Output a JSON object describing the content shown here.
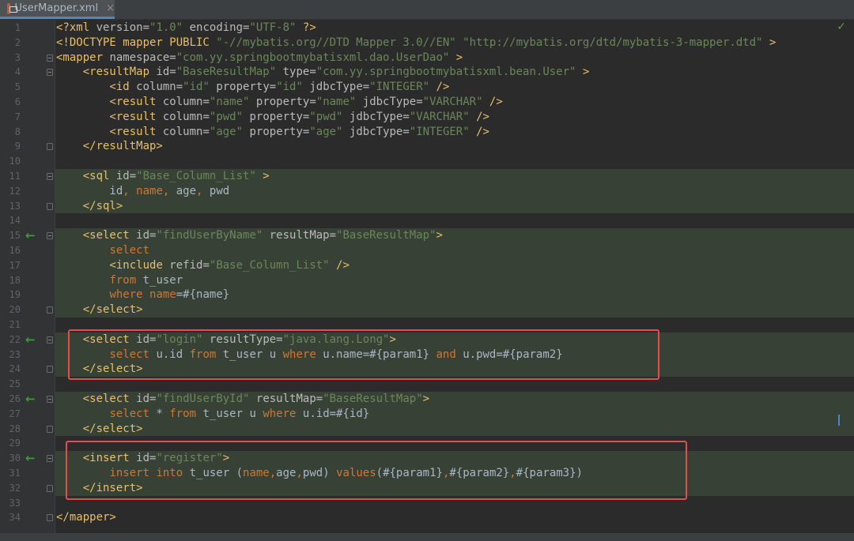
{
  "tab": {
    "filename": "UserMapper.xml",
    "close": "×"
  },
  "status": {
    "inspection_icon": "check-icon",
    "inspection_text": "✓"
  },
  "lines": [
    {
      "n": "1",
      "tokens": [
        [
          "tg",
          "<?xml "
        ],
        [
          "an",
          "version="
        ],
        [
          "av",
          "\"1.0\""
        ],
        [
          "an",
          " encoding="
        ],
        [
          "av",
          "\"UTF-8\""
        ],
        [
          "tg",
          " ?>"
        ]
      ]
    },
    {
      "n": "2",
      "tokens": [
        [
          "tg",
          "<!DOCTYPE mapper PUBLIC "
        ],
        [
          "av",
          "\"-//mybatis.org//DTD Mapper 3.0//EN\""
        ],
        [
          "tg",
          " "
        ],
        [
          "av",
          "\"http://mybatis.org/dtd/mybatis-3-mapper.dtd\""
        ],
        [
          "tg",
          " >"
        ]
      ]
    },
    {
      "n": "3",
      "tokens": [
        [
          "tg",
          "<mapper"
        ],
        [
          "an",
          " namespace="
        ],
        [
          "av",
          "\"com.yy.springbootmybatisxml.dao.UserDao\""
        ],
        [
          "tg",
          " >"
        ]
      ]
    },
    {
      "n": "4",
      "tokens": [
        [
          "tx",
          "    "
        ],
        [
          "tg",
          "<resultMap"
        ],
        [
          "an",
          " id="
        ],
        [
          "av",
          "\"BaseResultMap\""
        ],
        [
          "an",
          " type="
        ],
        [
          "av",
          "\"com.yy.springbootmybatisxml.bean.User\""
        ],
        [
          "tg",
          " >"
        ]
      ]
    },
    {
      "n": "5",
      "tokens": [
        [
          "tx",
          "        "
        ],
        [
          "tg",
          "<id"
        ],
        [
          "an",
          " column="
        ],
        [
          "av",
          "\"id\""
        ],
        [
          "an",
          " property="
        ],
        [
          "av",
          "\"id\""
        ],
        [
          "an",
          " jdbcType="
        ],
        [
          "av",
          "\"INTEGER\""
        ],
        [
          "tg",
          " />"
        ]
      ]
    },
    {
      "n": "6",
      "tokens": [
        [
          "tx",
          "        "
        ],
        [
          "tg",
          "<result"
        ],
        [
          "an",
          " column="
        ],
        [
          "av",
          "\"name\""
        ],
        [
          "an",
          " property="
        ],
        [
          "av",
          "\"name\""
        ],
        [
          "an",
          " jdbcType="
        ],
        [
          "av",
          "\"VARCHAR\""
        ],
        [
          "tg",
          " />"
        ]
      ]
    },
    {
      "n": "7",
      "tokens": [
        [
          "tx",
          "        "
        ],
        [
          "tg",
          "<result"
        ],
        [
          "an",
          " column="
        ],
        [
          "av",
          "\"pwd\""
        ],
        [
          "an",
          " property="
        ],
        [
          "av",
          "\"pwd\""
        ],
        [
          "an",
          " jdbcType="
        ],
        [
          "av",
          "\"VARCHAR\""
        ],
        [
          "tg",
          " />"
        ]
      ]
    },
    {
      "n": "8",
      "tokens": [
        [
          "tx",
          "        "
        ],
        [
          "tg",
          "<result"
        ],
        [
          "an",
          " column="
        ],
        [
          "av",
          "\"age\""
        ],
        [
          "an",
          " property="
        ],
        [
          "av",
          "\"age\""
        ],
        [
          "an",
          " jdbcType="
        ],
        [
          "av",
          "\"INTEGER\""
        ],
        [
          "tg",
          " />"
        ]
      ]
    },
    {
      "n": "9",
      "tokens": [
        [
          "tx",
          "    "
        ],
        [
          "tg",
          "</resultMap>"
        ]
      ]
    },
    {
      "n": "10",
      "tokens": []
    },
    {
      "n": "11",
      "tokens": [
        [
          "tx",
          "    "
        ],
        [
          "tg",
          "<sql"
        ],
        [
          "an",
          " id="
        ],
        [
          "av",
          "\"Base_Column_List\""
        ],
        [
          "tg",
          " >"
        ]
      ]
    },
    {
      "n": "12",
      "tokens": [
        [
          "tx",
          "        id"
        ],
        [
          "kw",
          ", "
        ],
        [
          "kw",
          "name"
        ],
        [
          "kw",
          ", "
        ],
        [
          "tx",
          "age"
        ],
        [
          "kw",
          ", "
        ],
        [
          "tx",
          "pwd"
        ]
      ]
    },
    {
      "n": "13",
      "tokens": [
        [
          "tx",
          "    "
        ],
        [
          "tg",
          "</sql>"
        ]
      ]
    },
    {
      "n": "14",
      "tokens": []
    },
    {
      "n": "15",
      "tokens": [
        [
          "tx",
          "    "
        ],
        [
          "tg",
          "<select"
        ],
        [
          "an",
          " id="
        ],
        [
          "av",
          "\"findUserByName\""
        ],
        [
          "an",
          " resultMap="
        ],
        [
          "av",
          "\"BaseResultMap\""
        ],
        [
          "tg",
          ">"
        ]
      ]
    },
    {
      "n": "16",
      "tokens": [
        [
          "tx",
          "        "
        ],
        [
          "kw",
          "select"
        ]
      ]
    },
    {
      "n": "17",
      "tokens": [
        [
          "tx",
          "        "
        ],
        [
          "tg",
          "<include"
        ],
        [
          "an",
          " refid="
        ],
        [
          "av",
          "\"Base_Column_List\""
        ],
        [
          "tg",
          " />"
        ]
      ]
    },
    {
      "n": "18",
      "tokens": [
        [
          "tx",
          "        "
        ],
        [
          "kw",
          "from"
        ],
        [
          "tx",
          " t_user"
        ]
      ]
    },
    {
      "n": "19",
      "tokens": [
        [
          "tx",
          "        "
        ],
        [
          "kw",
          "where"
        ],
        [
          "tx",
          " "
        ],
        [
          "kw",
          "name"
        ],
        [
          "tx",
          "=#{name}"
        ]
      ]
    },
    {
      "n": "20",
      "tokens": [
        [
          "tx",
          "    "
        ],
        [
          "tg",
          "</select>"
        ]
      ]
    },
    {
      "n": "21",
      "tokens": []
    },
    {
      "n": "22",
      "tokens": [
        [
          "tx",
          "    "
        ],
        [
          "tg",
          "<select"
        ],
        [
          "an",
          " id="
        ],
        [
          "av",
          "\"login\""
        ],
        [
          "an",
          " resultType="
        ],
        [
          "av",
          "\"java.lang.Long\""
        ],
        [
          "tg",
          ">"
        ]
      ]
    },
    {
      "n": "23",
      "tokens": [
        [
          "tx",
          "        "
        ],
        [
          "kw",
          "select"
        ],
        [
          "tx",
          " u.id "
        ],
        [
          "kw",
          "from"
        ],
        [
          "tx",
          " t_user u "
        ],
        [
          "kw",
          "where"
        ],
        [
          "tx",
          " u.name=#{param1} "
        ],
        [
          "kw",
          "and"
        ],
        [
          "tx",
          " u.pwd=#{param2}"
        ]
      ]
    },
    {
      "n": "24",
      "tokens": [
        [
          "tx",
          "    "
        ],
        [
          "tg",
          "</select>"
        ]
      ]
    },
    {
      "n": "25",
      "tokens": []
    },
    {
      "n": "26",
      "tokens": [
        [
          "tx",
          "    "
        ],
        [
          "tg",
          "<select"
        ],
        [
          "an",
          " id="
        ],
        [
          "av",
          "\"findUserById\""
        ],
        [
          "an",
          " resultMap="
        ],
        [
          "av",
          "\"BaseResultMap\""
        ],
        [
          "tg",
          ">"
        ]
      ]
    },
    {
      "n": "27",
      "tokens": [
        [
          "tx",
          "        "
        ],
        [
          "kw",
          "select"
        ],
        [
          "tx",
          " * "
        ],
        [
          "kw",
          "from"
        ],
        [
          "tx",
          " t_user u "
        ],
        [
          "kw",
          "where"
        ],
        [
          "tx",
          " u.id=#{id}"
        ]
      ]
    },
    {
      "n": "28",
      "tokens": [
        [
          "tx",
          "    "
        ],
        [
          "tg",
          "</select>"
        ]
      ]
    },
    {
      "n": "29",
      "tokens": []
    },
    {
      "n": "30",
      "tokens": [
        [
          "tx",
          "    "
        ],
        [
          "tg",
          "<insert"
        ],
        [
          "an",
          " id="
        ],
        [
          "av",
          "\"register\""
        ],
        [
          "tg",
          ">"
        ]
      ]
    },
    {
      "n": "31",
      "tokens": [
        [
          "tx",
          "        "
        ],
        [
          "kw",
          "insert into"
        ],
        [
          "tx",
          " t_user ("
        ],
        [
          "kw",
          "name"
        ],
        [
          "kw",
          ","
        ],
        [
          "tx",
          "age"
        ],
        [
          "kw",
          ","
        ],
        [
          "tx",
          "pwd) "
        ],
        [
          "kw",
          "values"
        ],
        [
          "tx",
          "(#{param1}"
        ],
        [
          "kw",
          ","
        ],
        [
          "tx",
          "#{param2}"
        ],
        [
          "kw",
          ","
        ],
        [
          "tx",
          "#{param3})"
        ]
      ]
    },
    {
      "n": "32",
      "tokens": [
        [
          "tx",
          "    "
        ],
        [
          "tg",
          "</insert>"
        ]
      ]
    },
    {
      "n": "33",
      "tokens": []
    },
    {
      "n": "34",
      "tokens": [
        [
          "tg",
          "</mapper>"
        ]
      ]
    }
  ],
  "arrow_lines": [
    "15",
    "22",
    "26",
    "30"
  ],
  "arrow_glyph": "←"
}
